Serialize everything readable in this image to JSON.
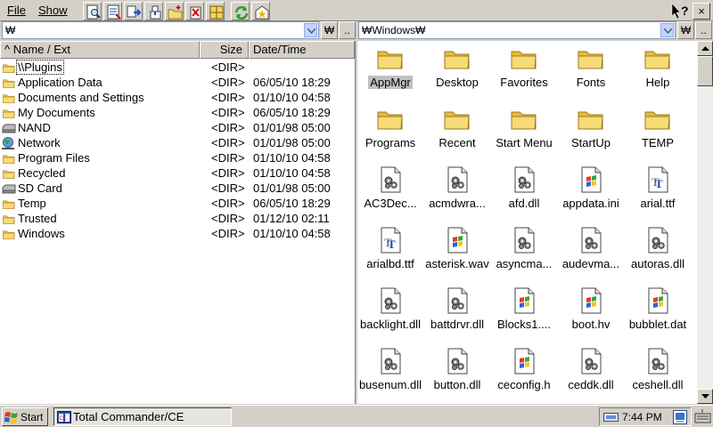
{
  "menubar": {
    "file_label": "File",
    "show_label": "Show"
  },
  "toolbar": {
    "buttons": [
      "find-icon",
      "view-icon",
      "copy-icon",
      "move-icon",
      "new-folder-icon",
      "delete-icon",
      "properties-icon",
      "refresh-icon",
      "favorites-icon"
    ],
    "help_label": "?",
    "close_label": "×"
  },
  "left_path": {
    "value": "₩",
    "root_label": "₩",
    "up_label": ".."
  },
  "right_path": {
    "value": "₩Windows₩",
    "root_label": "₩",
    "up_label": ".."
  },
  "columns": {
    "name": "^ Name / Ext",
    "size": "Size",
    "date": "Date/Time"
  },
  "left_files": [
    {
      "name": "\\\\Plugins",
      "size": "",
      "date": "",
      "icon": "folder"
    },
    {
      "name": "Application Data",
      "size": "<DIR>",
      "date": "06/05/10 18:29",
      "icon": "folder"
    },
    {
      "name": "Documents and Settings",
      "size": "<DIR>",
      "date": "01/10/10 04:58",
      "icon": "folder"
    },
    {
      "name": "My Documents",
      "size": "<DIR>",
      "date": "06/05/10 18:29",
      "icon": "folder"
    },
    {
      "name": "NAND",
      "size": "<DIR>",
      "date": "01/01/98 05:00",
      "icon": "drive"
    },
    {
      "name": "Network",
      "size": "<DIR>",
      "date": "01/01/98 05:00",
      "icon": "network"
    },
    {
      "name": "Program Files",
      "size": "<DIR>",
      "date": "01/10/10 04:58",
      "icon": "folder"
    },
    {
      "name": "Recycled",
      "size": "<DIR>",
      "date": "01/10/10 04:58",
      "icon": "folder"
    },
    {
      "name": "SD Card",
      "size": "<DIR>",
      "date": "01/01/98 05:00",
      "icon": "drive"
    },
    {
      "name": "Temp",
      "size": "<DIR>",
      "date": "06/05/10 18:29",
      "icon": "folder"
    },
    {
      "name": "Trusted",
      "size": "<DIR>",
      "date": "01/12/10 02:11",
      "icon": "folder"
    },
    {
      "name": "Windows",
      "size": "<DIR>",
      "date": "01/10/10 04:58",
      "icon": "folder"
    }
  ],
  "plugins_size": "<DIR>",
  "right_items": [
    {
      "label": "AppMgr",
      "icon": "folder"
    },
    {
      "label": "Desktop",
      "icon": "folder"
    },
    {
      "label": "Favorites",
      "icon": "folder"
    },
    {
      "label": "Fonts",
      "icon": "folder"
    },
    {
      "label": "Help",
      "icon": "folder"
    },
    {
      "label": "Programs",
      "icon": "folder"
    },
    {
      "label": "Recent",
      "icon": "folder"
    },
    {
      "label": "Start Menu",
      "icon": "folder"
    },
    {
      "label": "StartUp",
      "icon": "folder"
    },
    {
      "label": "TEMP",
      "icon": "folder"
    },
    {
      "label": "AC3Dec...",
      "icon": "gear-file"
    },
    {
      "label": "acmdwra...",
      "icon": "gear-file"
    },
    {
      "label": "afd.dll",
      "icon": "gear-file"
    },
    {
      "label": "appdata.ini",
      "icon": "windows-file"
    },
    {
      "label": "arial.ttf",
      "icon": "font-file"
    },
    {
      "label": "arialbd.ttf",
      "icon": "font-file"
    },
    {
      "label": "asterisk.wav",
      "icon": "windows-file"
    },
    {
      "label": "asyncma...",
      "icon": "gear-file"
    },
    {
      "label": "audevma...",
      "icon": "gear-file"
    },
    {
      "label": "autoras.dll",
      "icon": "gear-file"
    },
    {
      "label": "backlight.dll",
      "icon": "gear-file"
    },
    {
      "label": "battdrvr.dll",
      "icon": "gear-file"
    },
    {
      "label": "Blocks1....",
      "icon": "windows-file"
    },
    {
      "label": "boot.hv",
      "icon": "windows-file"
    },
    {
      "label": "bubblet.dat",
      "icon": "windows-file"
    },
    {
      "label": "busenum.dll",
      "icon": "gear-file"
    },
    {
      "label": "button.dll",
      "icon": "gear-file"
    },
    {
      "label": "ceconfig.h",
      "icon": "windows-file"
    },
    {
      "label": "ceddk.dll",
      "icon": "gear-file"
    },
    {
      "label": "ceshell.dll",
      "icon": "gear-file"
    }
  ],
  "taskbar": {
    "start_label": "Start",
    "task_label": "Total Commander/CE",
    "clock": "7:44 PM"
  },
  "colors": {
    "folder": "#f5d76e",
    "selection": "#c0c0c0",
    "chrome": "#d4d0c8"
  }
}
